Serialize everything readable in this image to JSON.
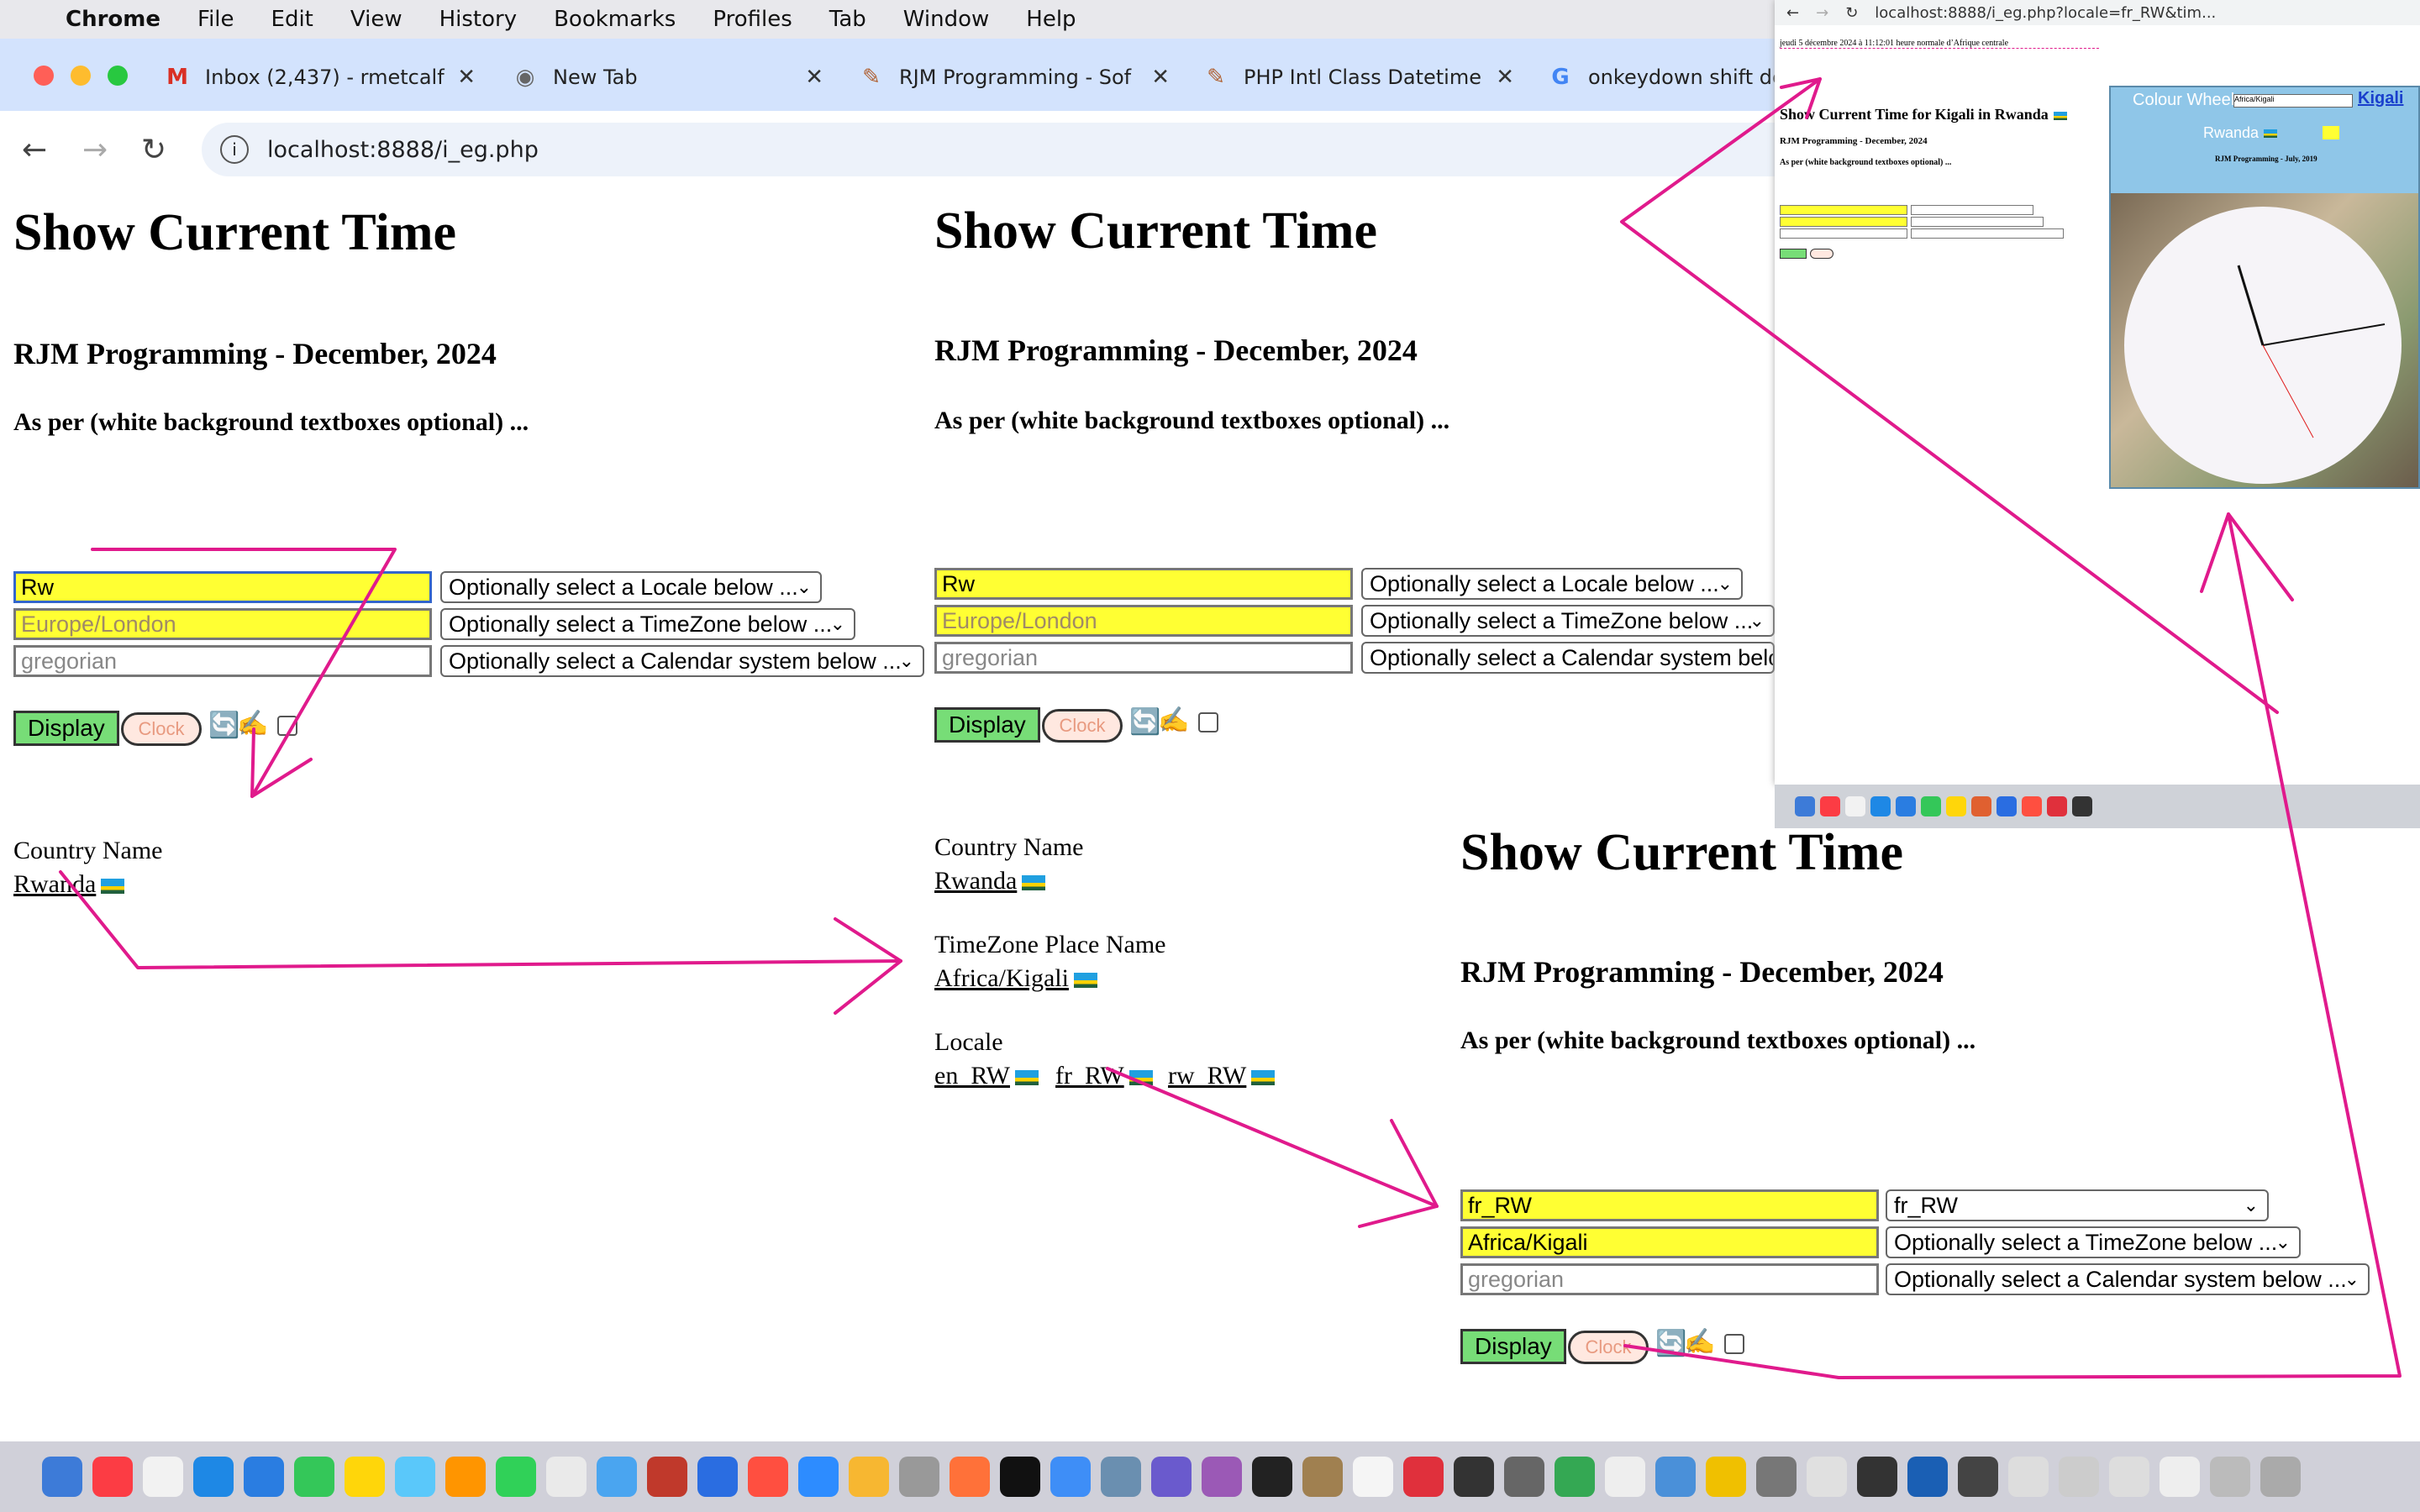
{
  "menubar": {
    "app": "Chrome",
    "items": [
      "File",
      "Edit",
      "View",
      "History",
      "Bookmarks",
      "Profiles",
      "Tab",
      "Window",
      "Help"
    ]
  },
  "tabs": [
    {
      "icon": "gmail-icon",
      "label": "Inbox (2,437) - rmetcalf"
    },
    {
      "icon": "chrome-icon",
      "label": "New Tab"
    },
    {
      "icon": "rjm-icon",
      "label": "RJM Programming - Sof"
    },
    {
      "icon": "rjm-icon",
      "label": "PHP Intl Class Datetime"
    },
    {
      "icon": "google-icon",
      "label": "onkeydown shift de"
    }
  ],
  "address": "localhost:8888/i_eg.php",
  "page": {
    "title": "Show Current Time",
    "subtitle": "RJM Programming - December, 2024",
    "note": "As per (white background textboxes optional) ..."
  },
  "panel1": {
    "locale_value": "Rw",
    "timezone_placeholder": "Europe/London",
    "calendar_placeholder": "gregorian",
    "locale_select": "Optionally select a Locale below ...",
    "timezone_select": "Optionally select a TimeZone below ...",
    "calendar_select": "Optionally select a Calendar system below ...",
    "display_label": "Display",
    "clock_label": "Clock",
    "country_label": "Country Name",
    "country_link": "Rwanda"
  },
  "panel2": {
    "locale_value": "Rw",
    "timezone_placeholder": "Europe/London",
    "calendar_placeholder": "gregorian",
    "locale_select": "Optionally select a Locale below ...",
    "timezone_select": "Optionally select a TimeZone below ...",
    "calendar_select": "Optionally select a Calendar system belo",
    "display_label": "Display",
    "clock_label": "Clock",
    "country_label": "Country Name",
    "country_link": "Rwanda",
    "tz_label": "TimeZone Place Name",
    "tz_link": "Africa/Kigali",
    "locale_label": "Locale",
    "locales": [
      "en_RW",
      "fr_RW",
      "rw_RW"
    ]
  },
  "panel3": {
    "locale_value": "fr_RW",
    "timezone_value": "Africa/Kigali",
    "calendar_placeholder": "gregorian",
    "locale_select": "fr_RW",
    "timezone_select": "Optionally select a TimeZone below ...",
    "calendar_select": "Optionally select a Calendar system below ...",
    "display_label": "Display",
    "clock_label": "Clock"
  },
  "popup": {
    "url": "localhost:8888/i_eg.php?locale=fr_RW&tim...",
    "datetime": "jeudi 5 décembre 2024 à 11:12:01 heure normale d’Afrique centrale",
    "title": "Show Current Time for Kigali in Rwanda",
    "subtitle": "RJM Programming - December, 2024",
    "note": "As per (white background textboxes optional) ...",
    "wheel_title": "Colour Wheel",
    "wheel_select": "Africa/Kigali",
    "wheel_link": "Kigali",
    "wheel_country": "Rwanda",
    "wheel_credit": "RJM Programming - July, 2019"
  },
  "colors": {
    "annotation_arrow": "#e01a8c",
    "textbox_yellow": "#ffff33",
    "display_green": "#77dd77"
  }
}
